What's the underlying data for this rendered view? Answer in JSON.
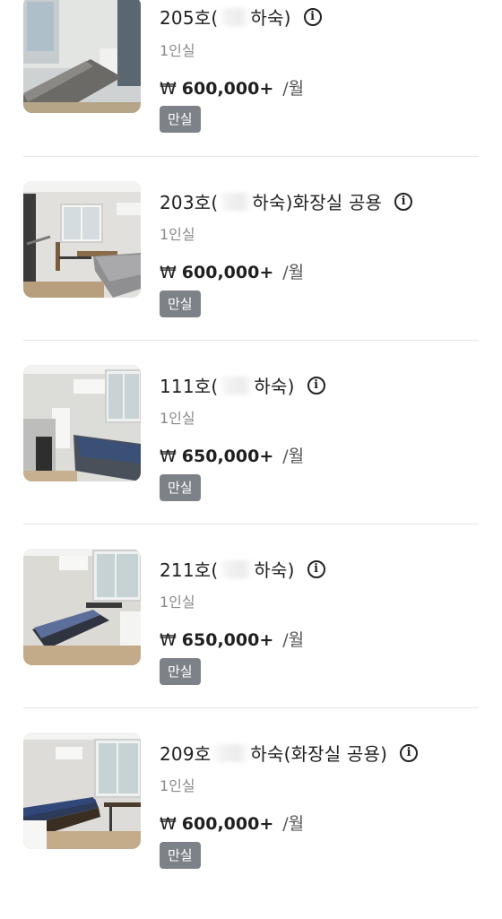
{
  "rooms": [
    {
      "room_number": "205호(",
      "name_suffix": "하숙)",
      "extra": "",
      "occupancy": "1인실",
      "currency": "₩",
      "price": "600,000+",
      "per": "/월",
      "badge": "만실"
    },
    {
      "room_number": "203호(",
      "name_suffix": "하숙)",
      "extra": "화장실 공용",
      "occupancy": "1인실",
      "currency": "₩",
      "price": "600,000+",
      "per": "/월",
      "badge": "만실"
    },
    {
      "room_number": "111호(",
      "name_suffix": "하숙)",
      "extra": "",
      "occupancy": "1인실",
      "currency": "₩",
      "price": "650,000+",
      "per": "/월",
      "badge": "만실"
    },
    {
      "room_number": "211호(",
      "name_suffix": "하숙)",
      "extra": "",
      "occupancy": "1인실",
      "currency": "₩",
      "price": "650,000+",
      "per": "/월",
      "badge": "만실"
    },
    {
      "room_number": "209호",
      "name_suffix": "하숙(화장실 공용)",
      "extra": "",
      "occupancy": "1인실",
      "currency": "₩",
      "price": "600,000+",
      "per": "/월",
      "badge": "만실"
    }
  ],
  "icons": {
    "info": "info-icon"
  },
  "colors": {
    "badge_bg": "#7d8288",
    "subtext": "#8a8a8a",
    "divider": "#e5e5e5"
  }
}
